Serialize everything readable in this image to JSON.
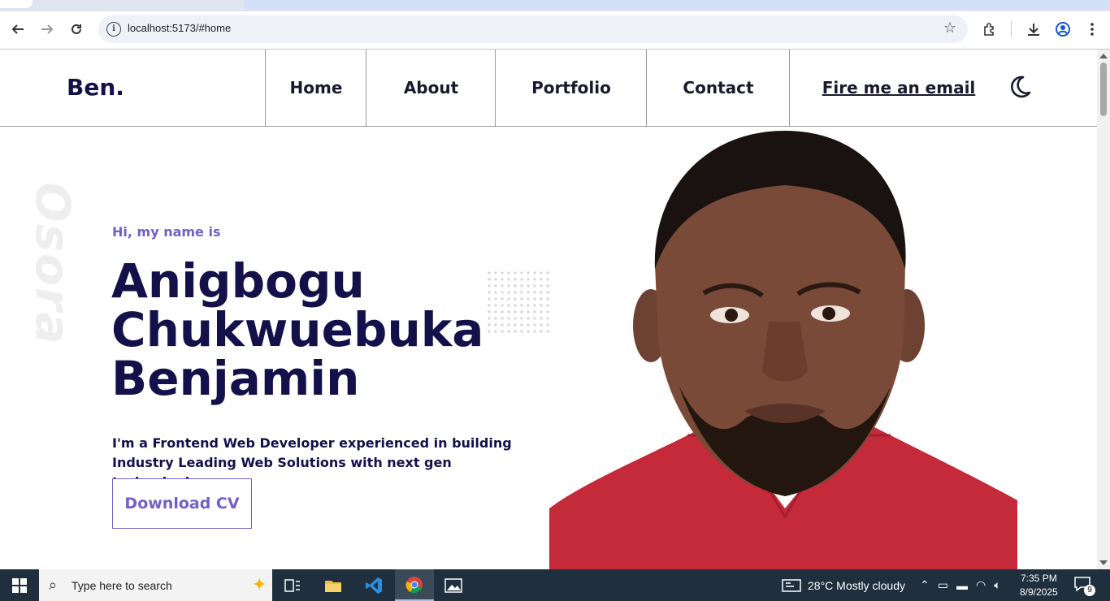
{
  "browser": {
    "url": "localhost:5173/#home",
    "icons": [
      "back-icon",
      "forward-icon",
      "reload-icon",
      "info-icon",
      "star-icon",
      "extensions-icon",
      "download-icon",
      "profile-icon",
      "menu-icon"
    ]
  },
  "header": {
    "logo": "Ben.",
    "nav": [
      "Home",
      "About",
      "Portfolio",
      "Contact"
    ],
    "email_link": "Fire me an email",
    "theme_icon": "moon-icon"
  },
  "hero": {
    "side_text": "Osora",
    "greeting": "Hi, my name is",
    "name_lines": [
      "Anigbogu",
      "Chukwuebuka",
      "Benjamin"
    ],
    "bio": "I'm a Frontend Web Developer experienced in building Industry Leading Web Solutions with next gen technologies.",
    "cta": "Download CV",
    "colors": {
      "accent": "#7060c8",
      "heading": "#14104a"
    }
  },
  "taskbar": {
    "search_placeholder": "Type here to search",
    "weather": "28°C  Mostly cloudy",
    "time": "7:35 PM",
    "date": "8/9/2025",
    "notification_count": "9"
  }
}
